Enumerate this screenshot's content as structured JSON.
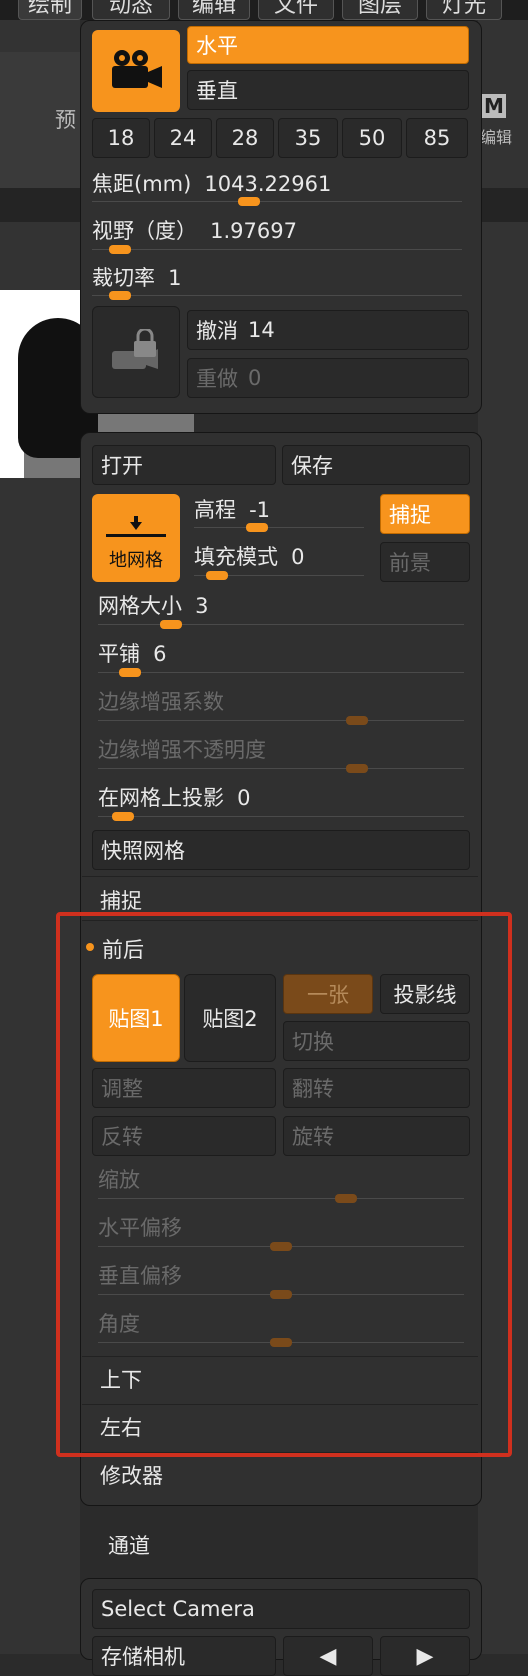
{
  "menubar": {
    "tabs": [
      "绘制",
      "动态",
      "编辑",
      "文件",
      "图层",
      "灯光"
    ]
  },
  "left_side": {
    "label_yu": "预"
  },
  "right_side": {
    "m_label": "M",
    "m_sub": "编辑"
  },
  "camera": {
    "orient_selected": "水平",
    "orient_other": "垂直",
    "focal_presets": [
      "18",
      "24",
      "28",
      "35",
      "50",
      "85"
    ],
    "focal_label": "焦距(mm)",
    "focal_value": "1043.22961",
    "fov_label": "视野（度）",
    "fov_value": "1.97697",
    "clip_label": "裁切率",
    "clip_value": "1",
    "undo_label": "撤消",
    "undo_value": "14",
    "redo_label": "重做",
    "redo_value": "0",
    "sliders": {
      "focal": 0.42,
      "fov": 0.05,
      "clip": 0.05
    }
  },
  "grid": {
    "open_label": "打开",
    "save_label": "保存",
    "floor_label": "地网格",
    "elevation_label": "高程",
    "elevation_value": "-1",
    "fill_mode_label": "填充模式",
    "fill_mode_value": "0",
    "snap_label": "捕捉",
    "foreground_label": "前景",
    "grid_size_label": "网格大小",
    "grid_size_value": "3",
    "tile_label": "平铺",
    "tile_value": "6",
    "edge_factor_label": "边缘增强系数",
    "edge_opacity_label": "边缘增强不透明度",
    "project_label": "在网格上投影",
    "project_value": "0",
    "snapshot_label": "快照网格",
    "sliders": {
      "elevation": 0.35,
      "fill": 0.08,
      "grid_size": 0.18,
      "tile": 0.06,
      "edge_factor": 0.72,
      "edge_opacity": 0.72,
      "project": 0.04
    }
  },
  "snap_section": {
    "title": "捕捉"
  },
  "front_back": {
    "title": "前后",
    "map1": "贴图1",
    "map2": "贴图2",
    "single": "一张",
    "projection_lines": "投影线",
    "switch": "切换",
    "adjust": "调整",
    "flip": "翻转",
    "invert": "反转",
    "rotate": "旋转",
    "scale": "缩放",
    "h_offset": "水平偏移",
    "v_offset": "垂直偏移",
    "angle": "角度",
    "up_down": "上下",
    "left_right": "左右",
    "sliders": {
      "scale": 0.69,
      "h_offset": 0.5,
      "v_offset": 0.5,
      "angle": 0.5
    }
  },
  "modifiers": {
    "title": "修改器"
  },
  "channels": {
    "title": "通道"
  },
  "bottom": {
    "select_camera": "Select Camera",
    "store_camera": "存储相机"
  },
  "colors": {
    "accent": "#f7941d",
    "highlight_box": "#d0301e",
    "panel": "#303030"
  }
}
